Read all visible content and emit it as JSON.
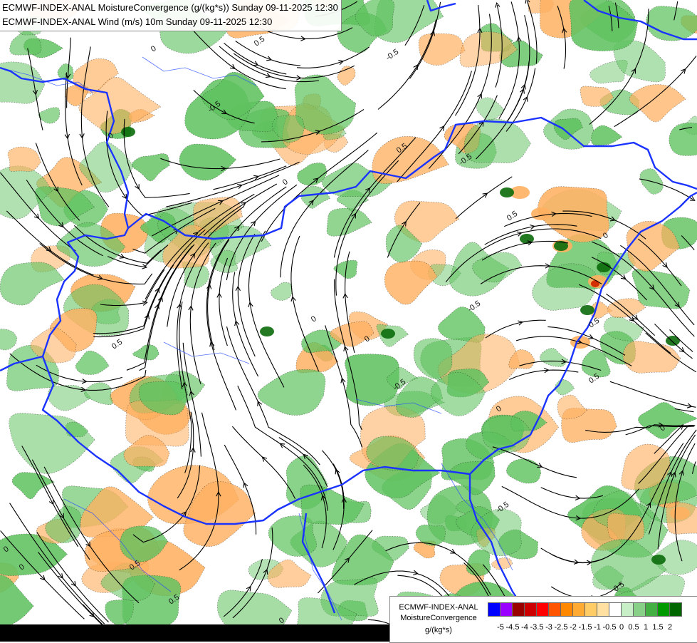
{
  "titles": {
    "line1": "ECMWF-INDEX-ANAL MoistureConvergence (g/(kg*s)) Sunday 09-11-2025 12:30",
    "line2": "ECMWF-INDEX-ANAL Wind (m/s) 10m Sunday 09-11-2025 12:30"
  },
  "legend": {
    "model": "ECMWF-INDEX-ANAL",
    "variable": "MoistureConvergence",
    "unit": "g/(kg*s)",
    "ticks": [
      "-5",
      "-4.5",
      "-4",
      "-3.5",
      "-3",
      "-2.5",
      "-2",
      "-1.5",
      "-1",
      "-0.5",
      "0",
      "0.5",
      "1",
      "1.5",
      "2"
    ],
    "colors": [
      "#0000ff",
      "#9900ff",
      "#990000",
      "#cc0000",
      "#ff0000",
      "#ff5500",
      "#ff8800",
      "#ffaa33",
      "#ffcc66",
      "#ffe0a0",
      "#ffffff",
      "#c8eec8",
      "#88d088",
      "#44b044",
      "#009900",
      "#006600"
    ]
  },
  "contour_labels": [
    "0.5",
    "-0.5",
    "0",
    "-0.5",
    "0",
    "0.5",
    "0",
    "-0.5",
    "0.5",
    "0",
    "-0.5",
    "0",
    "0.5",
    "0",
    "0.5",
    "-0.5",
    "0",
    "0.5",
    "0",
    "-0.5",
    "0.5",
    "0",
    "0.5",
    "0",
    "0.5",
    "0"
  ],
  "colors": {
    "border": "#1a33ff",
    "river": "#2a4dff",
    "streamline": "#000000",
    "positive": "#5fc25f",
    "negative": "#ffb060",
    "strong_positive": "#0b6b0b",
    "strong_negative": "#d23000"
  }
}
